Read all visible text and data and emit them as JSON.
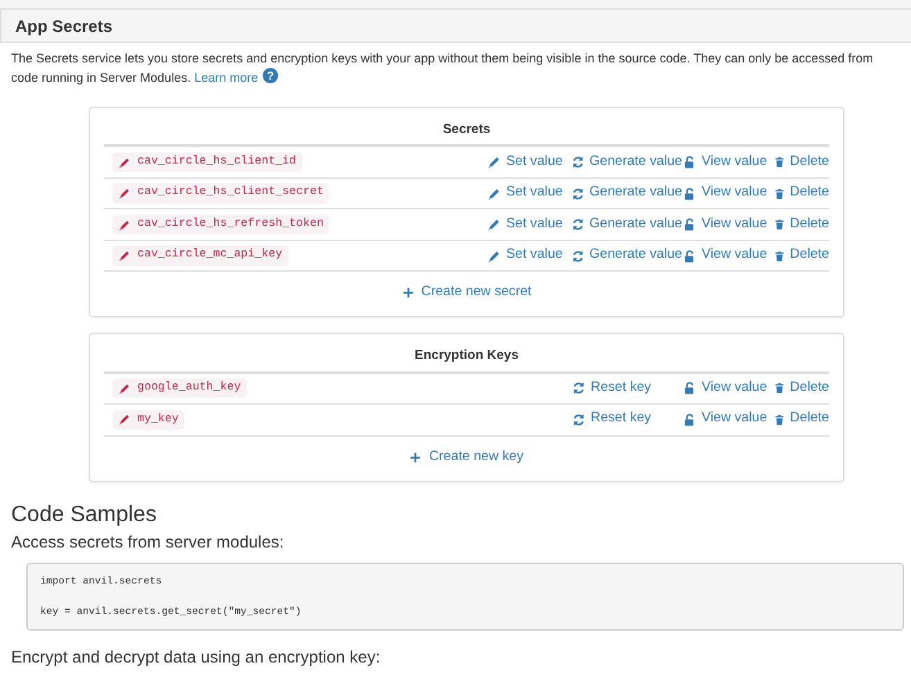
{
  "panel": {
    "title": "App Secrets"
  },
  "intro": {
    "text": "The Secrets service lets you store secrets and encryption keys with your app without them being visible in the source code. They can only be accessed from code running in Server Modules.",
    "link": "Learn more",
    "help_icon": "?"
  },
  "sections": [
    {
      "title": "Secrets",
      "create": "Create new secret",
      "rows": [
        {
          "name": "cav_circle_hs_client_id",
          "actions": [
            {
              "kind": "set",
              "label": "Set value"
            },
            {
              "kind": "generate",
              "label": "Generate value"
            },
            {
              "kind": "view",
              "label": "View value"
            },
            {
              "kind": "delete",
              "label": "Delete"
            }
          ]
        },
        {
          "name": "cav_circle_hs_client_secret",
          "actions": [
            {
              "kind": "set",
              "label": "Set value"
            },
            {
              "kind": "generate",
              "label": "Generate value"
            },
            {
              "kind": "view",
              "label": "View value"
            },
            {
              "kind": "delete",
              "label": "Delete"
            }
          ]
        },
        {
          "name": "cav_circle_hs_refresh_token",
          "actions": [
            {
              "kind": "set",
              "label": "Set value"
            },
            {
              "kind": "generate",
              "label": "Generate value"
            },
            {
              "kind": "view",
              "label": "View value"
            },
            {
              "kind": "delete",
              "label": "Delete"
            }
          ]
        },
        {
          "name": "cav_circle_mc_api_key",
          "actions": [
            {
              "kind": "set",
              "label": "Set value"
            },
            {
              "kind": "generate",
              "label": "Generate value"
            },
            {
              "kind": "view",
              "label": "View value"
            },
            {
              "kind": "delete",
              "label": "Delete"
            }
          ]
        }
      ]
    },
    {
      "title": "Encryption Keys",
      "create": "Create new key",
      "rows": [
        {
          "name": "google_auth_key",
          "actions": [
            {
              "kind": "generate",
              "label": "Reset key"
            },
            {
              "kind": "view",
              "label": "View value"
            },
            {
              "kind": "delete",
              "label": "Delete"
            }
          ]
        },
        {
          "name": "my_key",
          "actions": [
            {
              "kind": "generate",
              "label": "Reset key"
            },
            {
              "kind": "view",
              "label": "View value"
            },
            {
              "kind": "delete",
              "label": "Delete"
            }
          ]
        }
      ]
    }
  ],
  "code_samples": {
    "title": "Code Samples",
    "items": [
      {
        "caption": "Access secrets from server modules:",
        "blocks": [
          [
            "import anvil.secrets"
          ],
          [
            "key = anvil.secrets.get_secret(\"my_secret\")"
          ]
        ]
      },
      {
        "caption": "Encrypt and decrypt data using an encryption key:"
      }
    ]
  }
}
